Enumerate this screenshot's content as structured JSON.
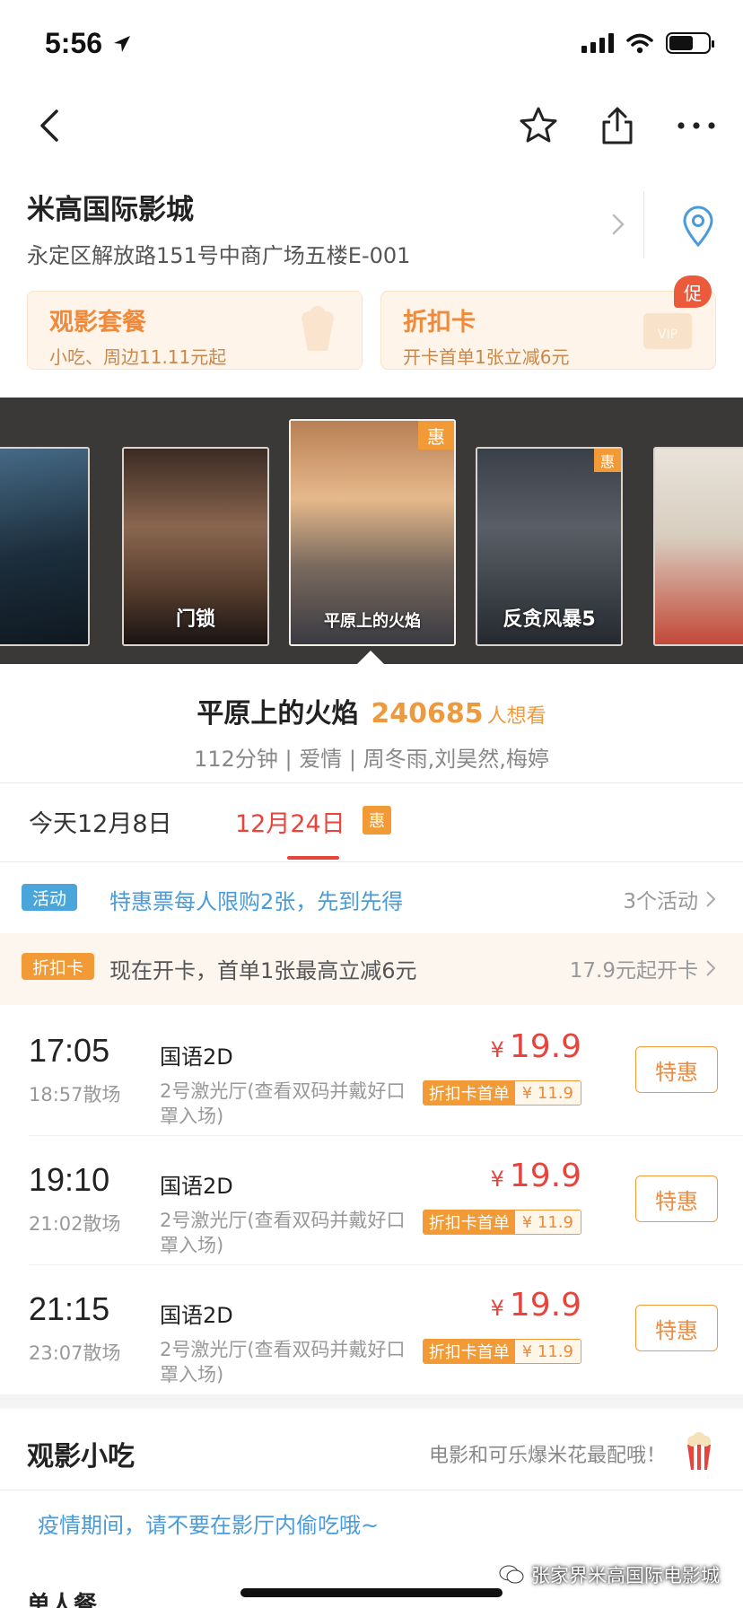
{
  "status_bar": {
    "time": "5:56"
  },
  "nav": {
    "icons": [
      "back-icon",
      "star-icon",
      "share-icon",
      "more-icon"
    ]
  },
  "cinema": {
    "name": "米高国际影城",
    "address": "永定区解放路151号中商广场五楼E-001"
  },
  "promos": [
    {
      "title": "观影套餐",
      "subtitle": "小吃、周边11.11元起",
      "icon": "popcorn-icon"
    },
    {
      "title": "折扣卡",
      "subtitle": "开卡首单1张立减6元",
      "icon": "vip-card-icon",
      "badge": "促"
    }
  ],
  "posters": [
    {
      "title": "",
      "colors": [
        "#1c2e3c",
        "#3a5870"
      ]
    },
    {
      "title": "门锁",
      "colors": [
        "#7a5a45",
        "#1a1412"
      ]
    },
    {
      "title": "平原上的火焰",
      "colors": [
        "#caa27e",
        "#42434a"
      ],
      "badge": "惠",
      "selected": true
    },
    {
      "title": "反贪风暴5",
      "colors": [
        "#2a3038",
        "#5a5e66"
      ],
      "badge": "惠"
    },
    {
      "title": "",
      "colors": [
        "#d8cdbf",
        "#c34838"
      ]
    }
  ],
  "movie": {
    "title": "平原上的火焰",
    "want_count": "240685",
    "want_label": "人想看",
    "meta": "112分钟 | 爱情 | 周冬雨,刘昊然,梅婷"
  },
  "date_tabs": {
    "today": "今天12月8日",
    "active": "12月24日",
    "active_badge": "惠"
  },
  "activity": {
    "tag": "活动",
    "text": "特惠票每人限购2张，先到先得",
    "right": "3个活动"
  },
  "discount": {
    "tag": "折扣卡",
    "text": "现在开卡，首单1张最高立减6元",
    "right": "17.9元起开卡"
  },
  "showtimes": [
    {
      "start": "17:05",
      "end": "18:57散场",
      "lang": "国语2D",
      "hall": "2号激光厅(查看双码并戴好口罩入场)",
      "currency": "¥",
      "price": "19.9",
      "card_label": "折扣卡首单",
      "card_price": "¥ 11.9",
      "button": "特惠"
    },
    {
      "start": "19:10",
      "end": "21:02散场",
      "lang": "国语2D",
      "hall": "2号激光厅(查看双码并戴好口罩入场)",
      "currency": "¥",
      "price": "19.9",
      "card_label": "折扣卡首单",
      "card_price": "¥ 11.9",
      "button": "特惠"
    },
    {
      "start": "21:15",
      "end": "23:07散场",
      "lang": "国语2D",
      "hall": "2号激光厅(查看双码并戴好口罩入场)",
      "currency": "¥",
      "price": "19.9",
      "card_label": "折扣卡首单",
      "card_price": "¥ 11.9",
      "button": "特惠"
    }
  ],
  "snacks": {
    "title": "观影小吃",
    "hint": "电影和可乐爆米花最配哦！",
    "notice": "疫情期间，请不要在影厅内偷吃哦~",
    "sub_title": "单人餐"
  },
  "watermark": {
    "text": "张家界米高国际电影城"
  },
  "colors": {
    "accent_red": "#e6443c",
    "accent_orange": "#f29a36",
    "link_blue": "#4a9bd9"
  }
}
